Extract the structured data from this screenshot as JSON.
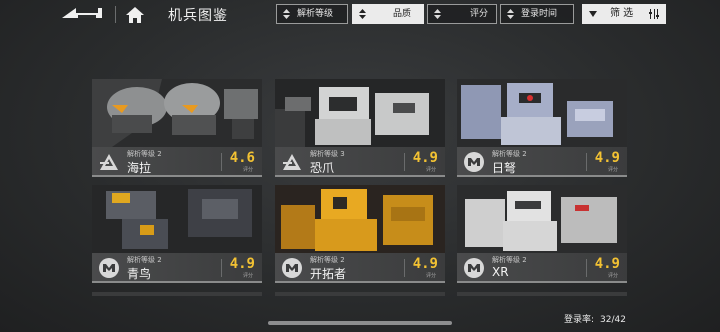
{
  "header": {
    "title": "机兵图鉴",
    "sort_buttons": [
      {
        "label": "解析等级",
        "active": false
      },
      {
        "label": "品质",
        "active": true
      },
      {
        "label": "评分",
        "active": false
      },
      {
        "label": "登录时间",
        "active": false
      }
    ],
    "filter_label": "筛 选"
  },
  "cards": [
    {
      "level": "解析等级 2",
      "name": "海拉",
      "score": "4.6",
      "score_label": "评分",
      "emblem": "a-emblem-icon"
    },
    {
      "level": "解析等级 3",
      "name": "恐爪",
      "score": "4.9",
      "score_label": "评分",
      "emblem": "a-emblem-icon"
    },
    {
      "level": "解析等级 2",
      "name": "日弩",
      "score": "4.9",
      "score_label": "评分",
      "emblem": "m-emblem-icon"
    },
    {
      "level": "解析等级 2",
      "name": "青鸟",
      "score": "4.9",
      "score_label": "评分",
      "emblem": "m-emblem-icon"
    },
    {
      "level": "解析等级 2",
      "name": "开拓者",
      "score": "4.9",
      "score_label": "评分",
      "emblem": "m-emblem-icon"
    },
    {
      "level": "解析等级 2",
      "name": "XR",
      "score": "4.9",
      "score_label": "评分",
      "emblem": "m-emblem-icon"
    }
  ],
  "footer": {
    "rate_label": "登录率:",
    "rate_value": "32/42"
  },
  "colors": {
    "score": "#f3c233",
    "background": "#2a2c2d"
  }
}
